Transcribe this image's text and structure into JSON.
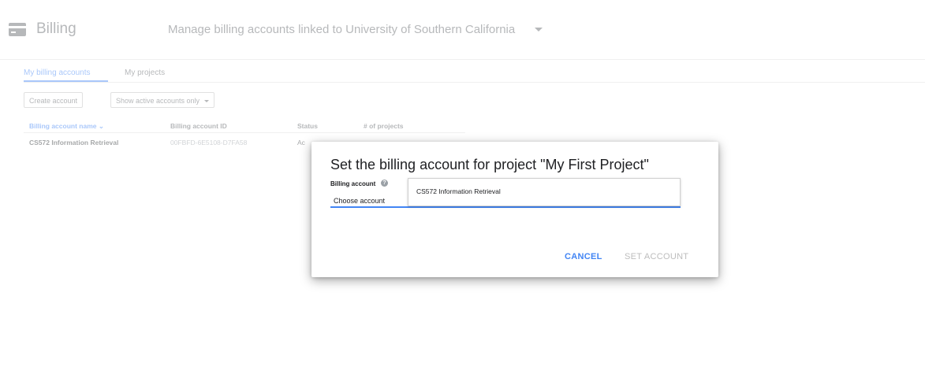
{
  "header": {
    "title": "Billing",
    "manage_text": "Manage billing accounts linked to University of Southern California"
  },
  "tabs": [
    {
      "label": "My billing accounts",
      "active": true
    },
    {
      "label": "My projects",
      "active": false
    }
  ],
  "toolbar": {
    "create_label": "Create account",
    "filter_label": "Show active accounts only"
  },
  "table": {
    "columns": [
      "Billing account name",
      "Billing account ID",
      "Status",
      "# of projects"
    ],
    "sorted_indicator": "⌄",
    "rows": [
      {
        "name": "CS572 Information Retrieval",
        "id": "00FBFD-6E5108-D7FA58",
        "status": "Ac"
      }
    ]
  },
  "dialog": {
    "title": "Set the billing account for project \"My First Project\"",
    "field_label": "Billing account",
    "help_glyph": "?",
    "select_value": "Choose account",
    "dropdown_option": "CS572 Information Retrieval",
    "cancel_label": "CANCEL",
    "set_label": "SET ACCOUNT"
  },
  "colors": {
    "accent": "#4285f4",
    "disabled": "#bdbdbd"
  }
}
